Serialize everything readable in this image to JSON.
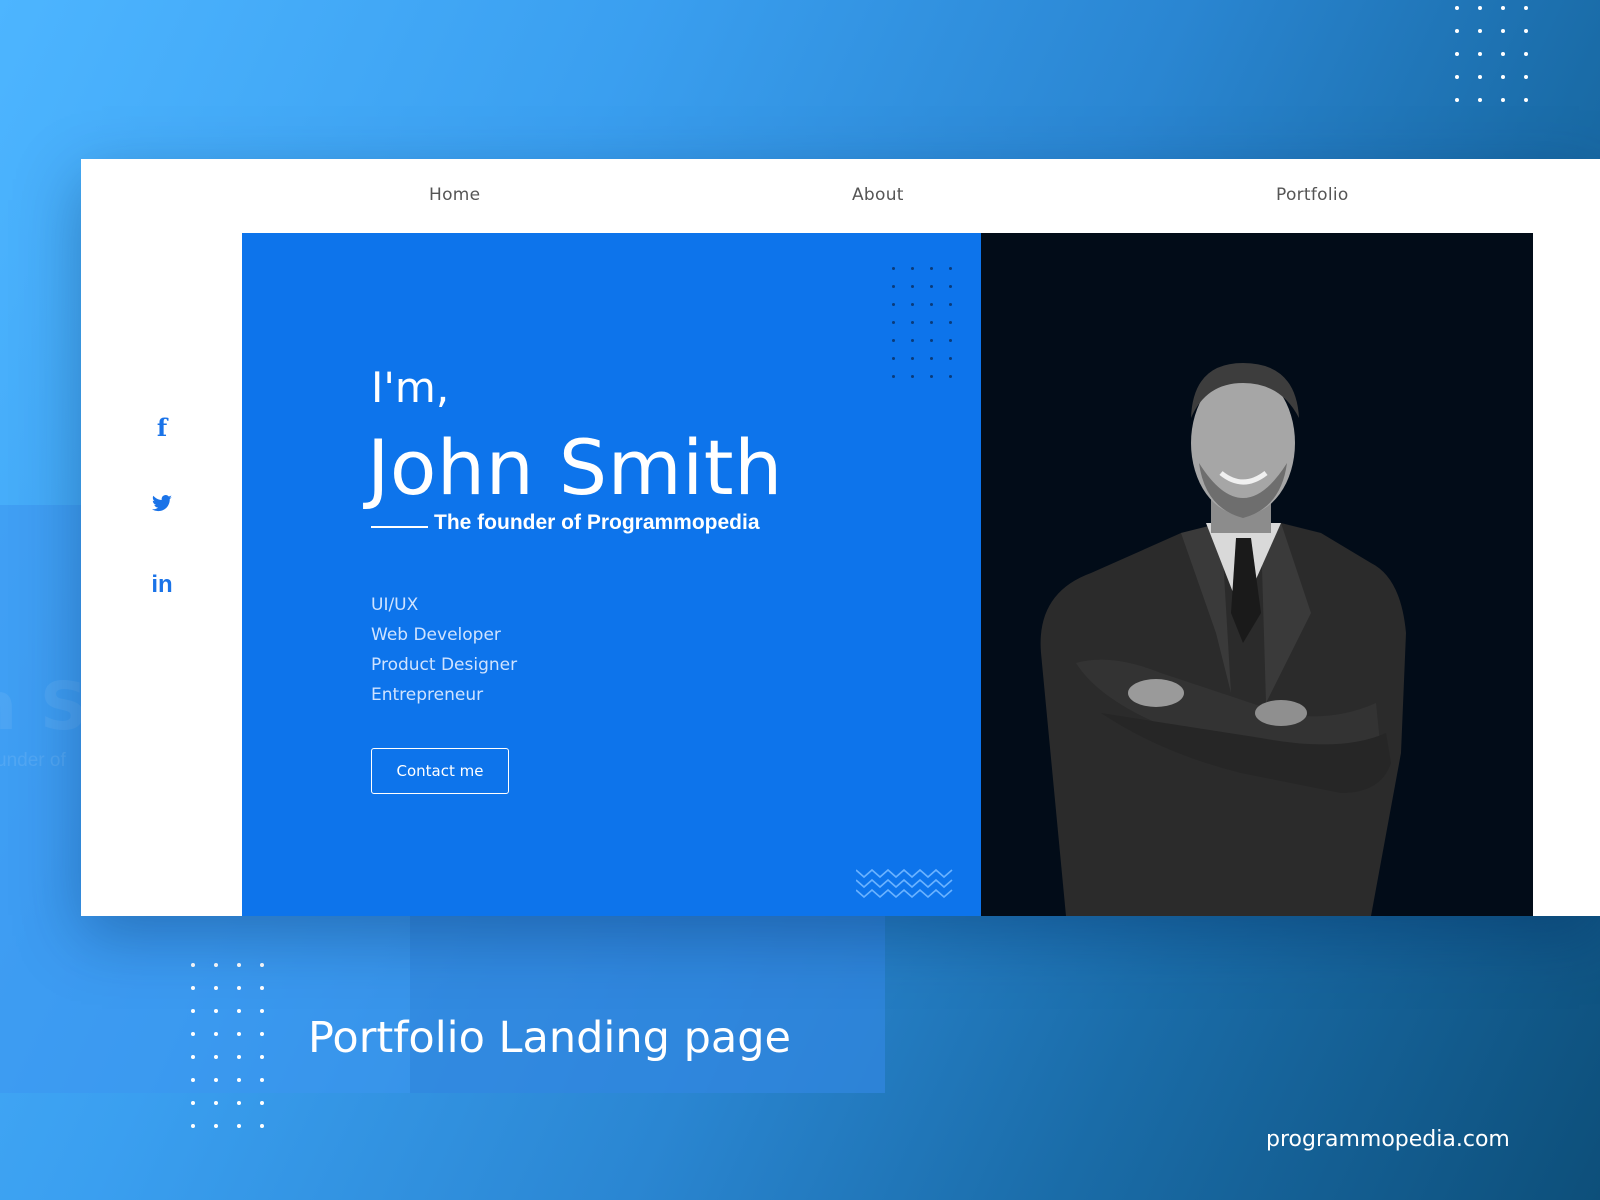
{
  "nav": {
    "items": [
      "Home",
      "About",
      "Portfolio"
    ]
  },
  "social": {
    "facebook": "f",
    "twitter": "twitter-bird",
    "linkedin": "in"
  },
  "hero": {
    "greeting": "I'm,",
    "name": "John Smith",
    "tagline": "The founder of Programmopedia",
    "roles": [
      "UI/UX",
      "Web Developer",
      "Product Designer",
      "Entrepreneur"
    ],
    "cta_label": "Contact me"
  },
  "background": {
    "ghost_name": "n S",
    "ghost_sub": "under of"
  },
  "caption": {
    "title": "Portfolio Landing page",
    "site": "programmopedia.com"
  },
  "colors": {
    "hero_blue": "#0d74eb",
    "hero_dark": "#020c18",
    "accent_icon": "#1a73e8"
  }
}
